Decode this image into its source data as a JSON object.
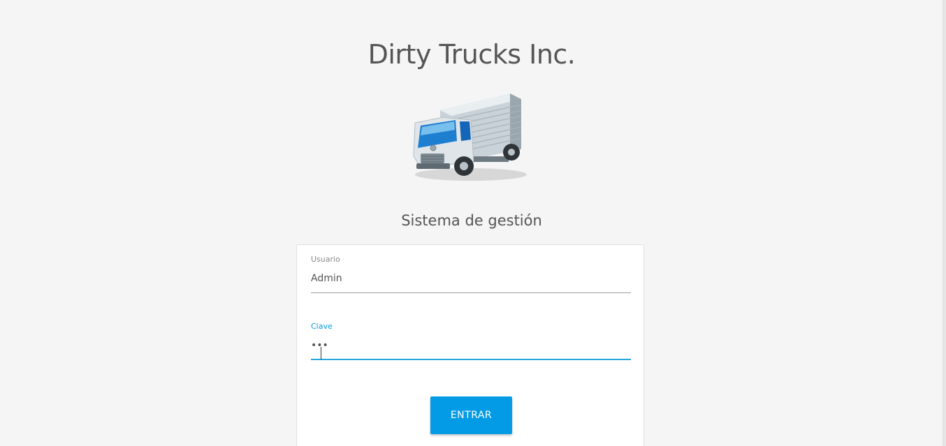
{
  "header": {
    "title": "Dirty Trucks Inc.",
    "logo_icon": "truck-icon",
    "subtitle": "Sistema de gestión"
  },
  "login": {
    "username_label": "Usuario",
    "username_value": "Admin",
    "password_label": "Clave",
    "password_value": "•••",
    "submit_label": "ENTRAR"
  },
  "colors": {
    "accent": "#039be5",
    "background": "#f5f5f5"
  }
}
